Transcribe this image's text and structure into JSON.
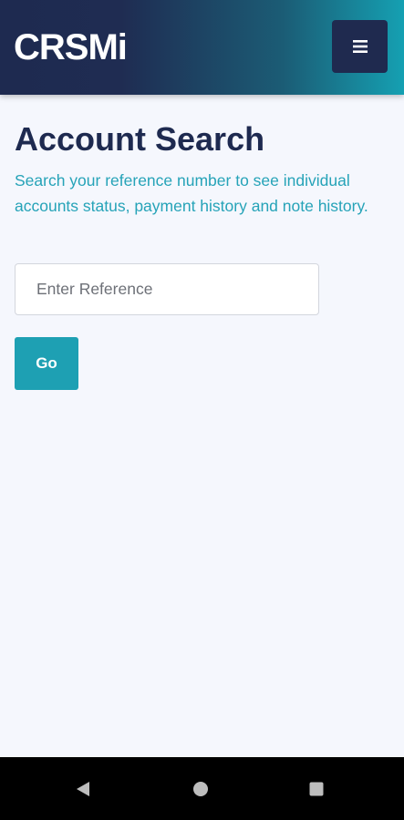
{
  "header": {
    "logo": "CRSMi",
    "menu_icon": "hamburger-menu-icon"
  },
  "main": {
    "title": "Account Search",
    "description": "Search your reference number to see individual accounts status, payment history and note history.",
    "search": {
      "placeholder": "Enter Reference",
      "value": ""
    },
    "go_label": "Go"
  },
  "system_nav": {
    "back_icon": "back-triangle-icon",
    "home_icon": "home-circle-icon",
    "recents_icon": "recents-square-icon"
  },
  "colors": {
    "navy": "#1e2a50",
    "teal": "#1ea0b3",
    "background": "#f5f7fd"
  }
}
